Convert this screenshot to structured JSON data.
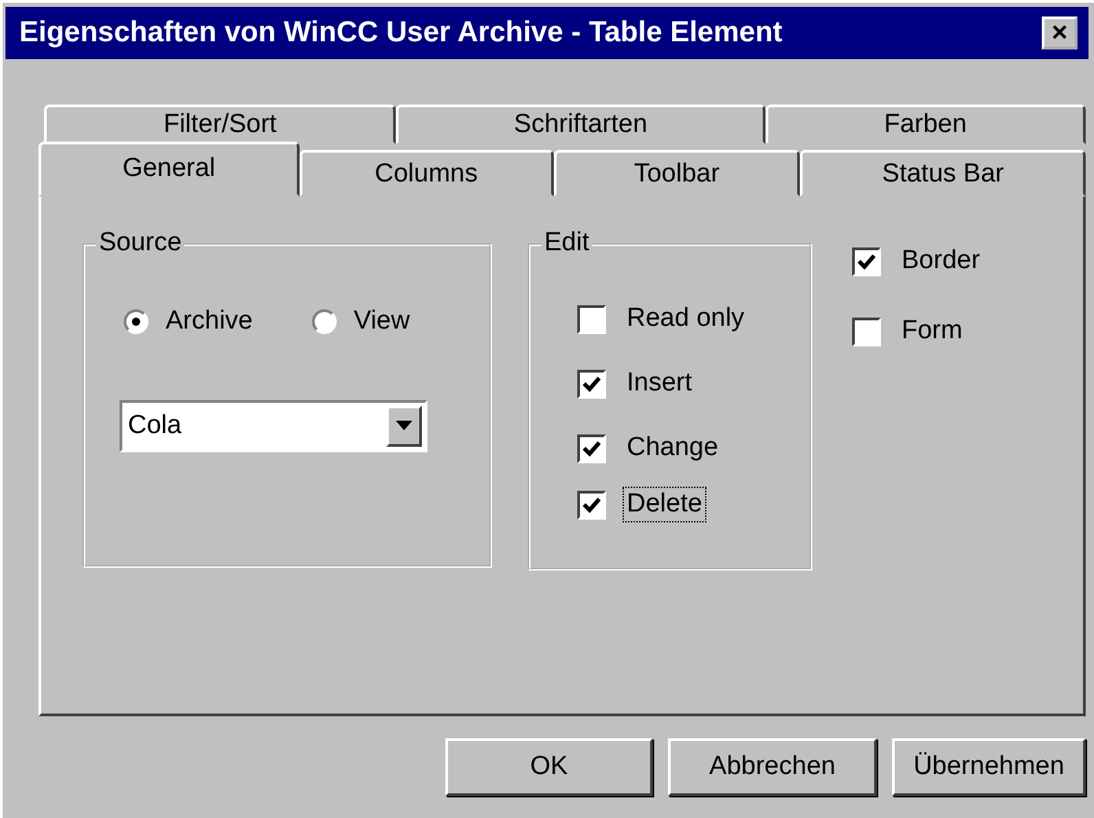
{
  "window": {
    "title": "Eigenschaften von WinCC User Archive - Table Element",
    "close": "×"
  },
  "tab_rows": [
    [
      {
        "label": "Filter/Sort",
        "selected": false
      },
      {
        "label": "Schriftarten",
        "selected": false
      },
      {
        "label": "Farben",
        "selected": false
      }
    ],
    [
      {
        "label": "General",
        "selected": true
      },
      {
        "label": "Columns",
        "selected": false
      },
      {
        "label": "Toolbar",
        "selected": false
      },
      {
        "label": "Status Bar",
        "selected": false
      }
    ]
  ],
  "source": {
    "title": "Source",
    "options": [
      {
        "label": "Archive",
        "selected": true
      },
      {
        "label": "View",
        "selected": false
      }
    ],
    "dropdown": {
      "value": "Cola"
    }
  },
  "edit": {
    "title": "Edit",
    "options": [
      {
        "label": "Read only",
        "checked": false,
        "focused": false
      },
      {
        "label": "Insert",
        "checked": true,
        "focused": false
      },
      {
        "label": "Change",
        "checked": true,
        "focused": false
      },
      {
        "label": "Delete",
        "checked": true,
        "focused": true
      }
    ]
  },
  "options": [
    {
      "label": "Border",
      "checked": true
    },
    {
      "label": "Form",
      "checked": false
    }
  ],
  "buttons": [
    "OK",
    "Abbrechen",
    "Übernehmen"
  ]
}
